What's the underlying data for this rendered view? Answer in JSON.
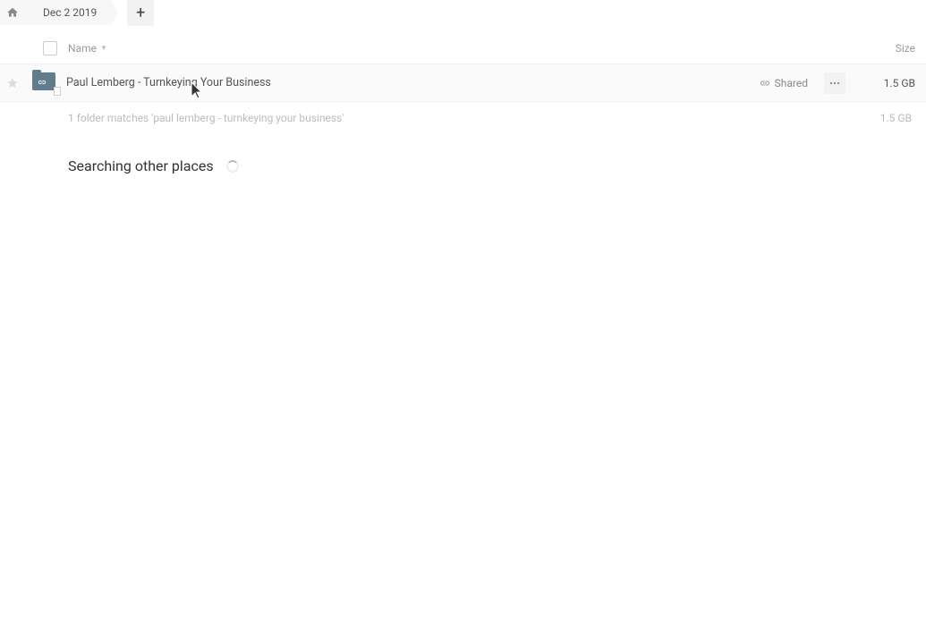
{
  "breadcrumb": {
    "home_icon": "home-icon",
    "current": "Dec 2 2019"
  },
  "toolbar": {
    "add_label": "+"
  },
  "columns": {
    "name": "Name",
    "size": "Size"
  },
  "rows": [
    {
      "name": "Paul Lemberg - Turnkeying Your Business",
      "shared_label": "Shared",
      "size": "1.5 GB",
      "icon": "shared-folder-icon",
      "starred": false
    }
  ],
  "summary": {
    "text": "1 folder matches 'paul lemberg - turnkeying your business'",
    "size": "1.5 GB"
  },
  "searching": {
    "label": "Searching other places"
  }
}
